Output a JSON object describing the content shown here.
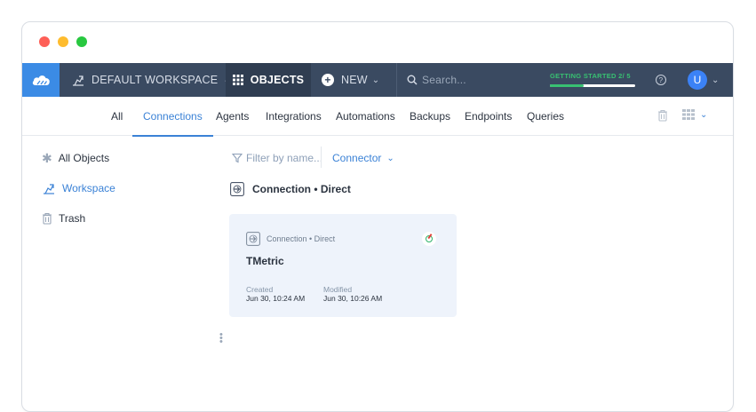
{
  "window": {
    "controls": [
      "close",
      "minimize",
      "maximize"
    ]
  },
  "topbar": {
    "logo_icon": "cloud-logo-icon",
    "workspace": {
      "label": "DEFAULT WORKSPACE",
      "icon": "workspace-icon"
    },
    "objects": {
      "label": "OBJECTS",
      "icon": "grid-icon"
    },
    "new": {
      "label": "NEW",
      "icon": "plus-circle-icon"
    },
    "search": {
      "placeholder": "Search..."
    },
    "getting_started": {
      "label": "GETTING STARTED 2/ 5",
      "progress": 0.4
    },
    "help_icon": "help-icon",
    "user": {
      "initial": "U"
    }
  },
  "tabs": [
    "All",
    "Connections",
    "Agents",
    "Integrations",
    "Automations",
    "Backups",
    "Endpoints",
    "Queries"
  ],
  "active_tab": "Connections",
  "sidebar": {
    "items": [
      {
        "label": "All Objects",
        "icon": "asterisk-icon"
      },
      {
        "label": "Workspace",
        "icon": "workspace-icon"
      },
      {
        "label": "Trash",
        "icon": "trash-icon"
      }
    ]
  },
  "filters": {
    "placeholder": "Filter by name...",
    "connector_label": "Connector"
  },
  "section": {
    "title": "Connection • Direct"
  },
  "card": {
    "type": "Connection • Direct",
    "title": "TMetric",
    "created_label": "Created",
    "created_value": "Jun 30, 10:24 AM",
    "modified_label": "Modified",
    "modified_value": "Jun 30, 10:26 AM"
  },
  "colors": {
    "nav_bg": "#3a4a61",
    "accent": "#3b82d6",
    "progress": "#38c172",
    "card_bg": "#eef3fb"
  }
}
